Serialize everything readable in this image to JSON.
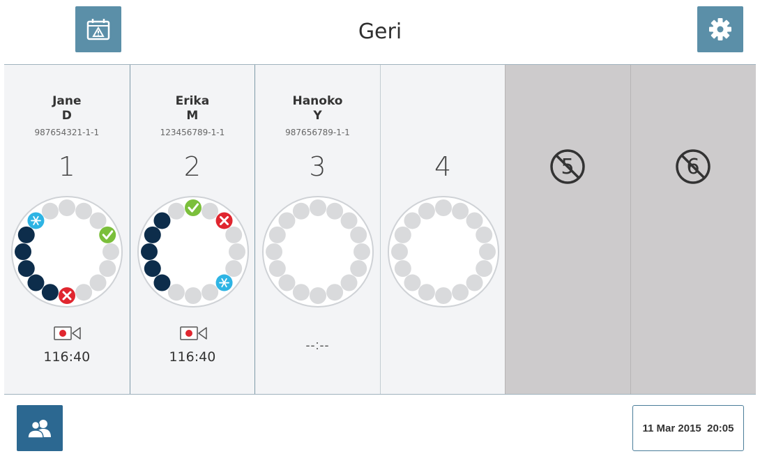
{
  "header": {
    "title": "Geri"
  },
  "icons": {
    "alarm": "calendar-warning-icon",
    "settings": "gear-icon",
    "patients": "users-icon"
  },
  "colors": {
    "accent": "#5b8fa8",
    "patients_button": "#2c6891",
    "well_filled": "#0d2d4b",
    "well_empty": "#d9dadc",
    "ok": "#7bbf3b",
    "error": "#e0262f",
    "frozen": "#2eb4e4",
    "disabled_panel": "#cdcbcc"
  },
  "panels": [
    {
      "first_name": "Jane",
      "last_initial": "D",
      "id": "987654321-1-1",
      "number": "1",
      "status": "recording",
      "time": "116:40"
    },
    {
      "first_name": "Erika",
      "last_initial": "M",
      "id": "123456789-1-1",
      "number": "2",
      "status": "recording",
      "time": "116:40"
    },
    {
      "first_name": "Hanoko",
      "last_initial": "Y",
      "id": "987656789-1-1",
      "number": "3",
      "status": "idle",
      "time": "--:--"
    },
    {
      "first_name": "",
      "last_initial": "",
      "id": "",
      "number": "4",
      "status": "empty",
      "time": ""
    },
    {
      "number": "5",
      "status": "disabled"
    },
    {
      "number": "6",
      "status": "disabled"
    }
  ],
  "wells": {
    "count": 16,
    "panel_1": {
      "filled": [
        9,
        10,
        11,
        12,
        13
      ],
      "frozen": [
        14
      ],
      "ok": [
        3
      ],
      "error": [
        8
      ]
    },
    "panel_2": {
      "filled": [
        10,
        11,
        12,
        13,
        14
      ],
      "frozen": [
        6
      ],
      "ok": [
        0
      ],
      "error": [
        2
      ]
    },
    "panel_3": {
      "filled": [],
      "frozen": [],
      "ok": [],
      "error": []
    },
    "panel_4": {
      "filled": [],
      "frozen": [],
      "ok": [],
      "error": []
    }
  },
  "footer": {
    "date": "11 Mar 2015",
    "time": "20:05"
  }
}
